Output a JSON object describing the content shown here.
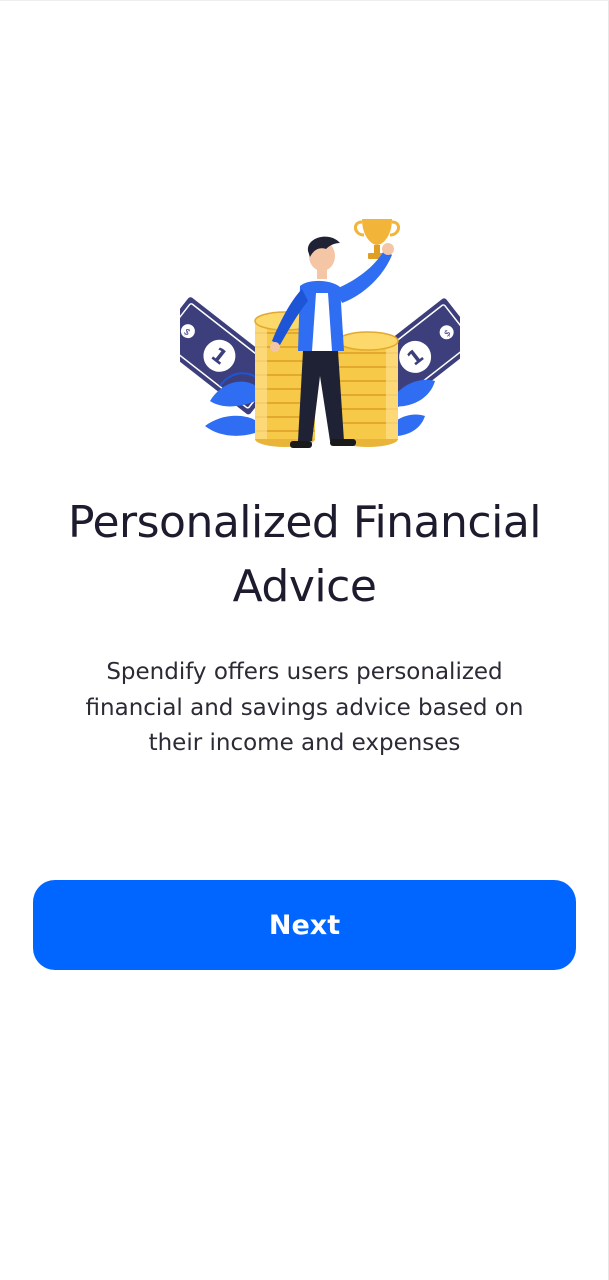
{
  "onboarding": {
    "illustration_icon": "trophy-money-coins-illustration",
    "title": "Personalized Financial Advice",
    "description": "Spendify offers users personalized financial and savings advice based on their income and expenses",
    "next_label": "Next"
  },
  "colors": {
    "primary": "#0066FF",
    "title_text": "#1C1C2E",
    "body_text": "#2B2B36",
    "bill": "#3C3F7C",
    "coin": "#F7C948",
    "leaf": "#2F6DF2"
  }
}
